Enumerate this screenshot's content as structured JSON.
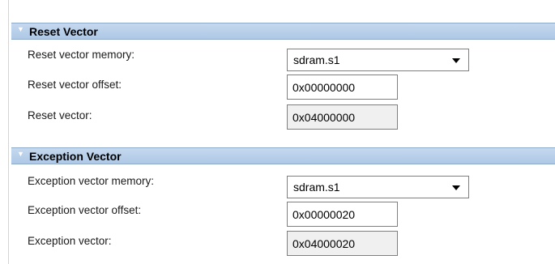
{
  "reset_section": {
    "title": "Reset Vector",
    "memory_label": "Reset vector memory:",
    "memory_value": "sdram.s1",
    "offset_label": "Reset vector offset:",
    "offset_value": "0x00000000",
    "vector_label": "Reset vector:",
    "vector_value": "0x04000000"
  },
  "exception_section": {
    "title": "Exception Vector",
    "memory_label": "Exception vector memory:",
    "memory_value": "sdram.s1",
    "offset_label": "Exception vector offset:",
    "offset_value": "0x00000020",
    "vector_label": "Exception vector:",
    "vector_value": "0x04000020"
  },
  "icons": {
    "collapse": "triangle-down-icon",
    "dropdown": "chevron-down-icon"
  },
  "colors": {
    "header_bg": "#b8cfea",
    "readonly_bg": "#f0f0f0"
  }
}
